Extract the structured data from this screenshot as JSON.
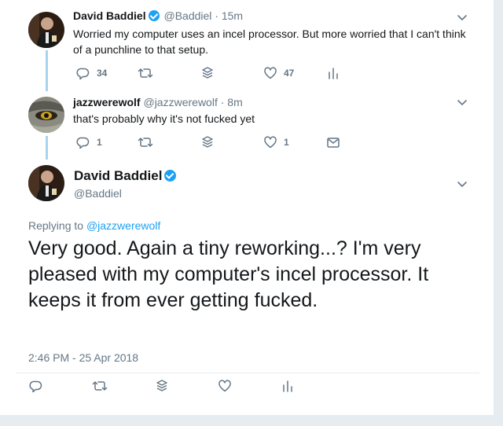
{
  "tweets": [
    {
      "name": "David Baddiel",
      "verified": true,
      "handle": "@Baddiel",
      "time": "· 15m",
      "text": "Worried my computer uses an incel processor. But more worried that I can't think of a punchline to that setup.",
      "replies": "34",
      "likes": "47"
    },
    {
      "name": "jazzwerewolf",
      "handle": "@jazzwerewolf",
      "time": "· 8m",
      "text": "that's probably why it's not fucked yet",
      "replies": "1",
      "likes": "1"
    }
  ],
  "main": {
    "name": "David Baddiel",
    "verified": true,
    "handle": "@Baddiel",
    "replying_label": "Replying to",
    "replying_handle": "@jazzwerewolf",
    "text": "Very good. Again a tiny reworking...? I'm very pleased with my computer's incel processor. It keeps it from ever getting fucked.",
    "timestamp": "2:46 PM - 25 Apr 2018"
  },
  "colors": {
    "accent": "#1da1f2",
    "muted": "#657786",
    "thread_line": "#a6d4ef"
  }
}
